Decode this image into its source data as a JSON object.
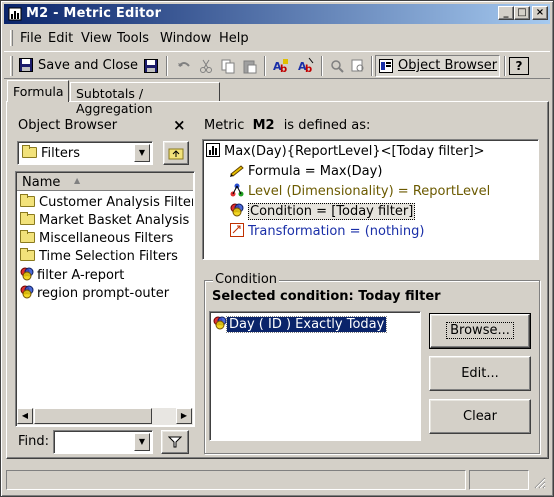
{
  "window": {
    "title": "M2 - Metric Editor",
    "caption_buttons": {
      "minimize": "_",
      "maximize": "□",
      "close": "×"
    }
  },
  "menu": [
    "File",
    "Edit",
    "View",
    "Tools",
    "Window",
    "Help"
  ],
  "toolbar": {
    "save_and_close": "Save and Close",
    "object_browser": "Object Browser",
    "help": "?"
  },
  "tabs": [
    "Formula",
    "Subtotals / Aggregation"
  ],
  "object_browser": {
    "header": "Object Browser",
    "close": "×",
    "folder_combo": "Filters",
    "column_name": "Name",
    "sort_indicator": "▲",
    "items": [
      {
        "label": "Customer Analysis Filters",
        "icon": "folder-icon"
      },
      {
        "label": "Market Basket Analysis Filt",
        "icon": "folder-icon"
      },
      {
        "label": "Miscellaneous Filters",
        "icon": "folder-icon"
      },
      {
        "label": "Time Selection Filters",
        "icon": "folder-icon"
      },
      {
        "label": "filter A-report",
        "icon": "filter-icon"
      },
      {
        "label": "region prompt-outer",
        "icon": "filter-icon"
      }
    ],
    "find_label": "Find:",
    "find_value": ""
  },
  "definition": {
    "prefix": "Metric",
    "metric_name": "M2",
    "suffix": "is defined as:",
    "root": "Max(Day){ReportLevel}<[Today filter]>",
    "children": [
      {
        "label": "Formula = Max(Day)",
        "icon": "formula-icon",
        "color": "#000000"
      },
      {
        "label": "Level (Dimensionality) = ReportLevel",
        "icon": "level-icon",
        "color": "#6b5a00"
      },
      {
        "label": "Condition = [Today filter]",
        "icon": "condition-icon",
        "color": "#000000"
      },
      {
        "label": "Transformation = (nothing)",
        "icon": "transformation-icon",
        "color": "#1a2fa8"
      }
    ]
  },
  "condition": {
    "group_label": "Condition",
    "selected_text": "Selected condition: Today filter",
    "expression": "Day ( ID ) Exactly Today",
    "buttons": {
      "browse": "Browse...",
      "edit": "Edit...",
      "clear": "Clear"
    }
  },
  "colors": {
    "titlebar_start": "#0a246a",
    "titlebar_end": "#a6caf0",
    "selection": "#0a246a"
  }
}
